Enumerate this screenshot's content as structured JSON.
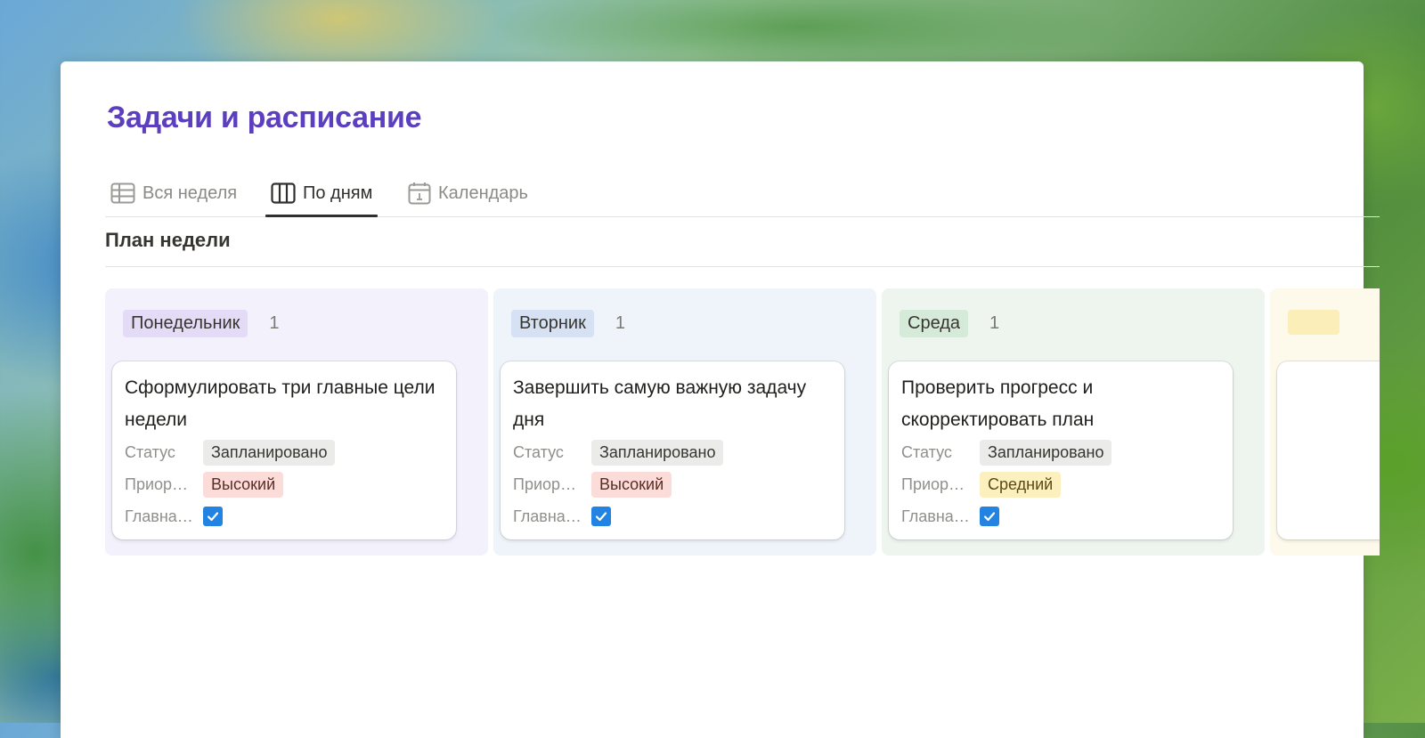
{
  "page": {
    "title": "Задачи и расписание"
  },
  "tabs": [
    {
      "label": "Вся неделя",
      "icon": "table-icon",
      "active": false
    },
    {
      "label": "По дням",
      "icon": "board-icon",
      "active": true
    },
    {
      "label": "Календарь",
      "icon": "calendar-icon",
      "active": false
    }
  ],
  "view": {
    "title": "План недели"
  },
  "props": {
    "status": "Статус",
    "priority": "Приор…",
    "main": "Главна…"
  },
  "columns": [
    {
      "label": "Понедельник",
      "count": "1",
      "card": {
        "title": "Сформулировать три главные цели недели",
        "status": "Запланировано",
        "priority": "Высокий",
        "main_checked": true
      }
    },
    {
      "label": "Вторник",
      "count": "1",
      "card": {
        "title": "Завершить самую важную задачу дня",
        "status": "Запланировано",
        "priority": "Высокий",
        "main_checked": true
      }
    },
    {
      "label": "Среда",
      "count": "1",
      "card": {
        "title": "Проверить прогресс и скорректировать план",
        "status": "Запланировано",
        "priority": "Средний",
        "main_checked": true
      }
    },
    {
      "label": "",
      "count": "",
      "card": {
        "title": "",
        "status": "",
        "priority": "",
        "main_checked": false
      }
    }
  ],
  "colors": {
    "title": "#5b3fbf",
    "checkbox": "#2383e2",
    "col_bg": [
      "#f3f1fc",
      "#eef4fa",
      "#eef5ef",
      "#fdfaec"
    ],
    "col_label_bg": [
      "#e4dcf7",
      "#d6e2f4",
      "#d6ead9",
      "#fbeeb8"
    ]
  }
}
